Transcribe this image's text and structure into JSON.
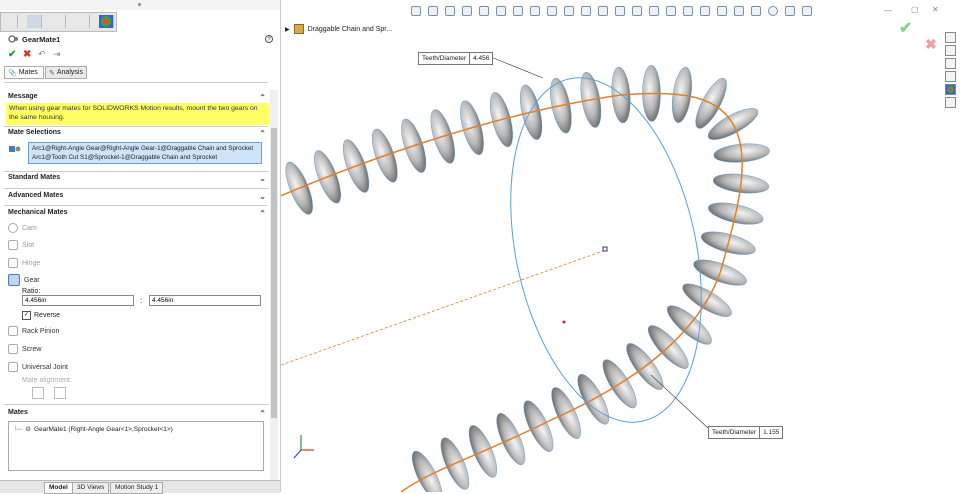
{
  "feature": {
    "title": "GearMate1"
  },
  "tabs": {
    "mates": "Mates",
    "analysis": "Analysis"
  },
  "message": {
    "header": "Message",
    "text": "When using gear mates for SOLIDWORKS Motion results, mount the two gears on the same housing."
  },
  "mate_selections": {
    "header": "Mate Selections",
    "items": [
      "Arc1@Right-Angle Gear@Right-Angle Gear-1@Draggable Chain and Sprocket",
      "Arc1@Tooth Cut S1@Sprocket-1@Draggable Chain and Sprocket"
    ]
  },
  "standard_mates": {
    "header": "Standard Mates"
  },
  "advanced_mates": {
    "header": "Advanced Mates"
  },
  "mechanical_mates": {
    "header": "Mechanical Mates",
    "items": [
      "Cam",
      "Slot",
      "Hinge",
      "Gear"
    ],
    "ratio_label": "Ratio:",
    "ratio_left": "4.456in",
    "ratio_sep": ":",
    "ratio_right": "4.456in",
    "reverse_label": "Reverse",
    "items2": [
      "Rack Pinion",
      "Screw",
      "Universal Joint"
    ],
    "mate_alignment": "Mate alignment:"
  },
  "mates": {
    "header": "Mates",
    "entry": "GearMate1 (Right-Angle Gear<1>,Sprocket<1>)"
  },
  "bottom_tabs": [
    "Model",
    "3D Views",
    "Motion Study 1"
  ],
  "tree": {
    "label": "Draggable Chain and Spr..."
  },
  "callouts": [
    {
      "label": "Teeth/Diameter",
      "value": "4.456"
    },
    {
      "label": "Teeth/Diameter",
      "value": "1.155"
    }
  ],
  "colors": {
    "accent": "#0b5fb0",
    "message_bg": "#ffff66",
    "selection_bg": "#cfe4f8",
    "path": "#e0802a",
    "ellipse": "#5aa0d8"
  }
}
